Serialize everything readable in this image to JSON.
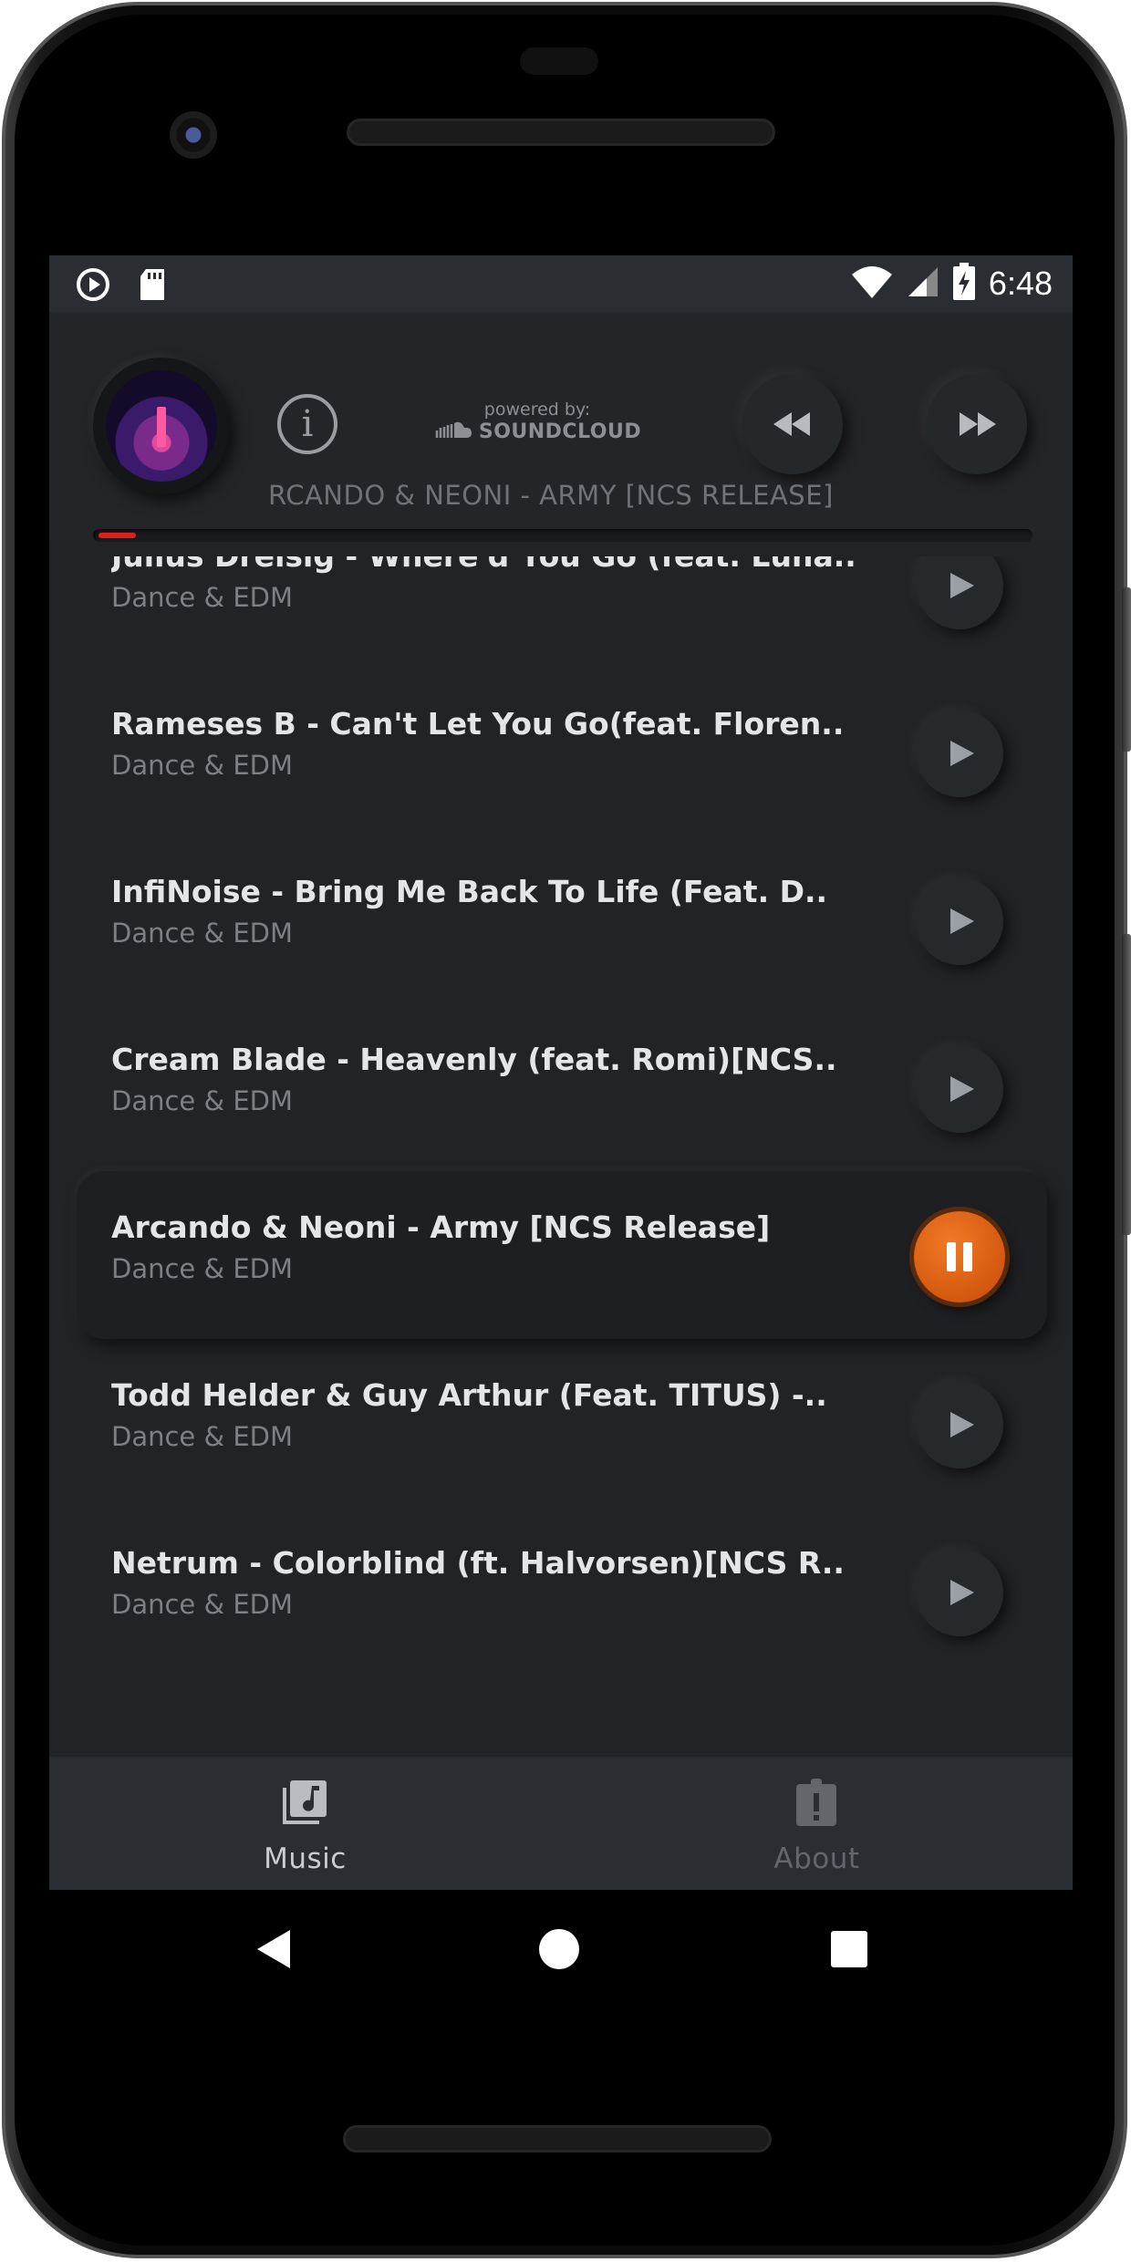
{
  "status_bar": {
    "time": "6:48",
    "left_icons": [
      "play-circle-icon",
      "sd-card-icon"
    ],
    "right_icons": [
      "wifi-icon",
      "signal-icon",
      "battery-charging-icon"
    ]
  },
  "player": {
    "album_art": "army-cover",
    "powered_by_label": "powered by:",
    "soundcloud_label": "SOUNDCLOUD",
    "now_playing_title": "RCANDO & NEONI - ARMY [NCS RELEASE]",
    "progress": 0.04,
    "progress_color": "#e0201e"
  },
  "tracks": [
    {
      "title": "Julius Dreisig - Where'd You Go (feat. Luna..",
      "genre": "Dance & EDM",
      "playing": false
    },
    {
      "title": "Rameses B - Can't Let You Go(feat. Floren..",
      "genre": "Dance & EDM",
      "playing": false
    },
    {
      "title": "InfiNoise - Bring Me Back To Life (Feat. D..",
      "genre": "Dance & EDM",
      "playing": false
    },
    {
      "title": "Cream Blade - Heavenly (feat. Romi)[NCS..",
      "genre": "Dance & EDM",
      "playing": false
    },
    {
      "title": "Arcando & Neoni - Army [NCS Release]",
      "genre": "Dance & EDM",
      "playing": true
    },
    {
      "title": "Todd Helder & Guy Arthur (Feat. TITUS) -..",
      "genre": "Dance & EDM",
      "playing": false
    },
    {
      "title": "Netrum - Colorblind (ft. Halvorsen)[NCS R..",
      "genre": "Dance & EDM",
      "playing": false
    }
  ],
  "bottom_nav": {
    "items": [
      {
        "label": "Music",
        "icon": "music-library-icon",
        "active": true
      },
      {
        "label": "About",
        "icon": "about-clipboard-icon",
        "active": false
      }
    ]
  },
  "colors": {
    "accent": "#e86a1a",
    "background": "#212326",
    "text_primary": "#e3e5e8",
    "text_secondary": "#7c8085"
  }
}
